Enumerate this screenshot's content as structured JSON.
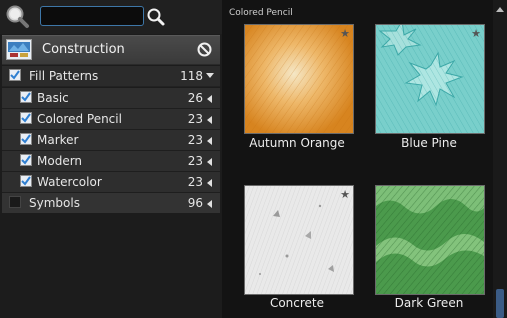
{
  "search": {
    "value": "",
    "placeholder": ""
  },
  "library": {
    "title": "Construction"
  },
  "tree": {
    "parent": {
      "label": "Fill Patterns",
      "count": "118",
      "checked": true
    },
    "children": [
      {
        "label": "Basic",
        "count": "26",
        "checked": true
      },
      {
        "label": "Colored Pencil",
        "count": "23",
        "checked": true
      },
      {
        "label": "Marker",
        "count": "23",
        "checked": true
      },
      {
        "label": "Modern",
        "count": "23",
        "checked": true
      },
      {
        "label": "Watercolor",
        "count": "23",
        "checked": true
      }
    ],
    "symbols": {
      "label": "Symbols",
      "count": "96",
      "checked": false
    }
  },
  "gallery": {
    "section_title": "Colored Pencil",
    "tiles": [
      {
        "label": "Autumn Orange",
        "favorite": true
      },
      {
        "label": "Blue Pine",
        "favorite": true
      },
      {
        "label": "Concrete",
        "favorite": true
      },
      {
        "label": "Dark Green",
        "favorite": false
      }
    ],
    "star_glyph": "★"
  },
  "colors": {
    "accent": "#3e77a8",
    "check": "#4a9fe0",
    "scroll_thumb": "#3b5c86"
  }
}
